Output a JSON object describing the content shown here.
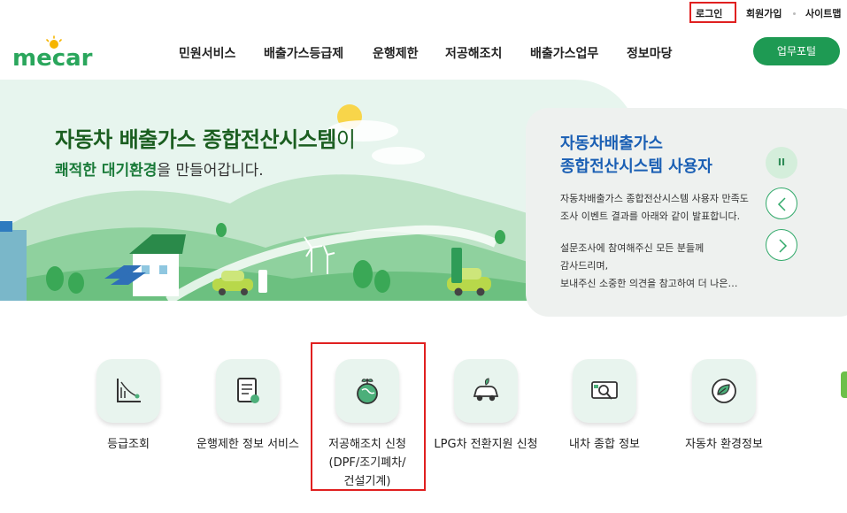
{
  "util": {
    "login": "로그인",
    "join": "회원가입",
    "sitemap": "사이트맵"
  },
  "brand": {
    "logo_text": "mecar",
    "accent": "#1e9a53"
  },
  "gnb": [
    "민원서비스",
    "배출가스등급제",
    "운행제한",
    "저공해조치",
    "배출가스업무",
    "정보마당"
  ],
  "portal_button": "업무포털",
  "hero": {
    "title_main": "자동차 배출가스 종합전산시스템",
    "title_tail": "이",
    "sub_strong": "쾌적한 대기환경",
    "sub_rest": "을 만들어갑니다."
  },
  "notice": {
    "title_line1": "자동차배출가스",
    "title_line2": "종합전산시스템 사용자",
    "p1_line1": "자동차배출가스 종합전산시스템 사용자 만족도",
    "p1_line2": "조사 이벤트 결과를 아래와 같이 발표합니다.",
    "p2_line1": "설문조사에 참여해주신 모든 분들께",
    "p2_line2": "감사드리며,",
    "p2_line3": "보내주신 소중한 의견을 참고하여 더 나은…",
    "pause_glyph": "II"
  },
  "quick_menu": [
    {
      "label": "등급조회",
      "icon": "grade-chart-icon"
    },
    {
      "label": "운행제한 정보 서비스",
      "icon": "document-check-icon"
    },
    {
      "label_lines": [
        "저공해조치 신청",
        "(DPF/조기폐차/",
        "건설기계)"
      ],
      "icon": "earth-sprout-icon"
    },
    {
      "label": "LPG차 전환지원 신청",
      "icon": "eco-car-icon"
    },
    {
      "label": "내차 종합 정보",
      "icon": "car-search-icon"
    },
    {
      "label": "자동차 환경정보",
      "icon": "leaf-car-icon"
    }
  ]
}
